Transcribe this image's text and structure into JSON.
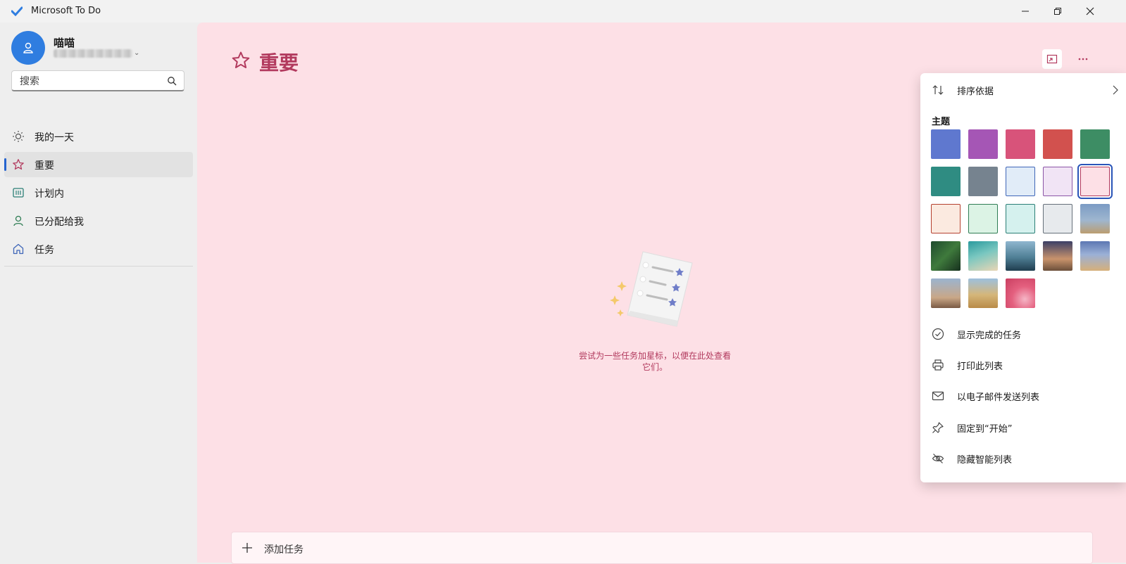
{
  "window": {
    "title": "Microsoft To Do"
  },
  "user": {
    "name": "喵喵"
  },
  "search": {
    "placeholder": "搜索"
  },
  "nav": [
    {
      "label": "我的一天",
      "icon": "sun-icon",
      "active": false
    },
    {
      "label": "重要",
      "icon": "star-icon",
      "active": true
    },
    {
      "label": "计划内",
      "icon": "calendar-grid-icon",
      "active": false
    },
    {
      "label": "已分配给我",
      "icon": "person-icon",
      "active": false
    },
    {
      "label": "任务",
      "icon": "home-icon",
      "active": false
    }
  ],
  "main": {
    "title": "重要",
    "empty_message": "尝试为一些任务加星标，以便在此处查看它们。",
    "add_task_label": "添加任务",
    "accent": "#b23a5e",
    "background": "#fde0e6"
  },
  "menu": {
    "sort_label": "排序依据",
    "theme_heading": "主题",
    "show_completed": "显示完成的任务",
    "print_list": "打印此列表",
    "email_list": "以电子邮件发送列表",
    "pin_start": "固定到“开始”",
    "hide_smart_list": "隐藏智能列表"
  },
  "themes": [
    {
      "name": "blue",
      "fill": "#5f78cf"
    },
    {
      "name": "purple",
      "fill": "#a556b5"
    },
    {
      "name": "rose",
      "fill": "#d8537a"
    },
    {
      "name": "red",
      "fill": "#d2514e"
    },
    {
      "name": "green",
      "fill": "#3d8d64"
    },
    {
      "name": "teal",
      "fill": "#2f8c82"
    },
    {
      "name": "slate",
      "fill": "#76838f"
    },
    {
      "name": "light-blue",
      "fill": "#e1ecf8",
      "border": "#3f66b8"
    },
    {
      "name": "light-purple",
      "fill": "#f1e4f5",
      "border": "#8b55a6"
    },
    {
      "name": "light-pink",
      "fill": "#fde0e6",
      "border": "#b23a5e",
      "selected": true
    },
    {
      "name": "light-peach",
      "fill": "#fbeae0",
      "border": "#b5412f"
    },
    {
      "name": "light-green",
      "fill": "#dcf3e5",
      "border": "#2f7d54"
    },
    {
      "name": "light-teal",
      "fill": "#d5f1ee",
      "border": "#2b7f76"
    },
    {
      "name": "light-gray",
      "fill": "#e7eaed",
      "border": "#66707a"
    },
    {
      "name": "photo-tower",
      "fill": "linear-gradient(180deg,#7b9bc4 0%,#9eb6cf 55%,#bb9d70 100%)"
    },
    {
      "name": "photo-palm-leaves",
      "fill": "linear-gradient(135deg,#1e4a2d 0%,#3f7a3c 50%,#16301e 100%)"
    },
    {
      "name": "photo-beach-aerial",
      "fill": "linear-gradient(160deg,#2a9b9e 0%,#7ac7c0 45%,#e9d6b5 100%)"
    },
    {
      "name": "photo-mountain-lake",
      "fill": "linear-gradient(180deg,#8fb6cf 0%,#4f7f95 55%,#1f3d4e 100%)"
    },
    {
      "name": "photo-sunset-palms",
      "fill": "linear-gradient(180deg,#3c4066 0%,#c9936c 60%,#6b4f3a 100%)"
    },
    {
      "name": "photo-desert-road",
      "fill": "linear-gradient(180deg,#5d78b3 0%,#9bb0d6 45%,#d6b07a 100%)"
    },
    {
      "name": "photo-lighthouse",
      "fill": "linear-gradient(180deg,#9bb4cf 0%,#c9a787 65%,#7a5a44 100%)"
    },
    {
      "name": "photo-poppy-field",
      "fill": "linear-gradient(180deg,#9dc0dd 0%,#d5b67a 55%,#b98b48 100%)"
    },
    {
      "name": "photo-pink-petal",
      "fill": "radial-gradient(circle at 65% 70%,#f5b6c6 0%,#e4607f 45%,#c93e60 100%)"
    }
  ]
}
